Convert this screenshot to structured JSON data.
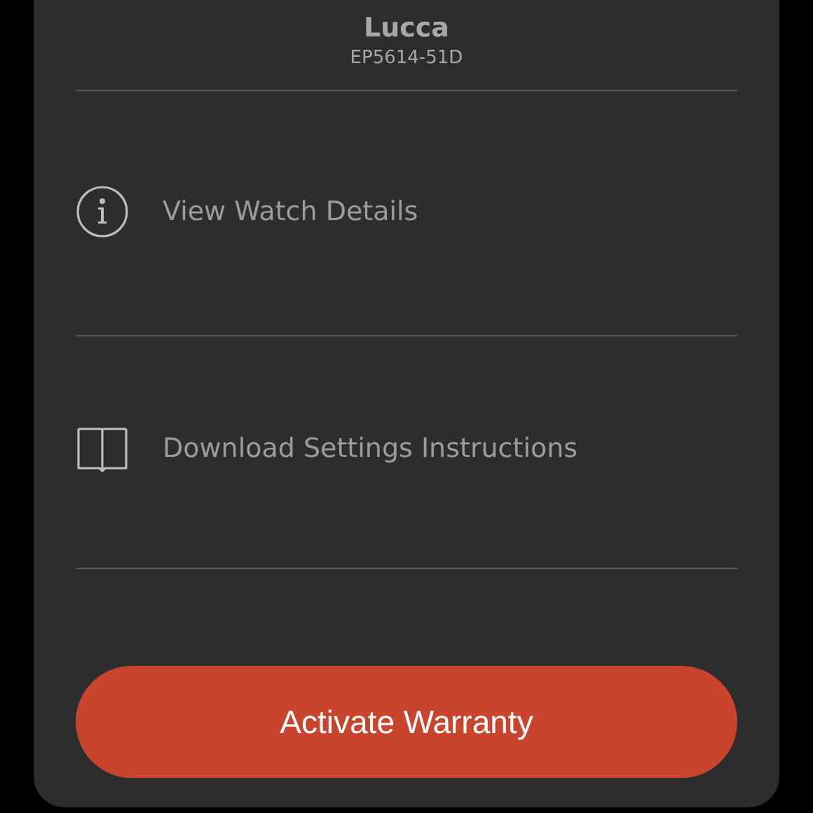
{
  "watch": {
    "name": "Lucca",
    "model": "EP5614-51D"
  },
  "menu_items": [
    {
      "kind": "info",
      "label": "View Watch Details"
    },
    {
      "kind": "book",
      "label": "Download Settings Instructions"
    }
  ],
  "primary_button": {
    "label": "Activate Warranty"
  }
}
